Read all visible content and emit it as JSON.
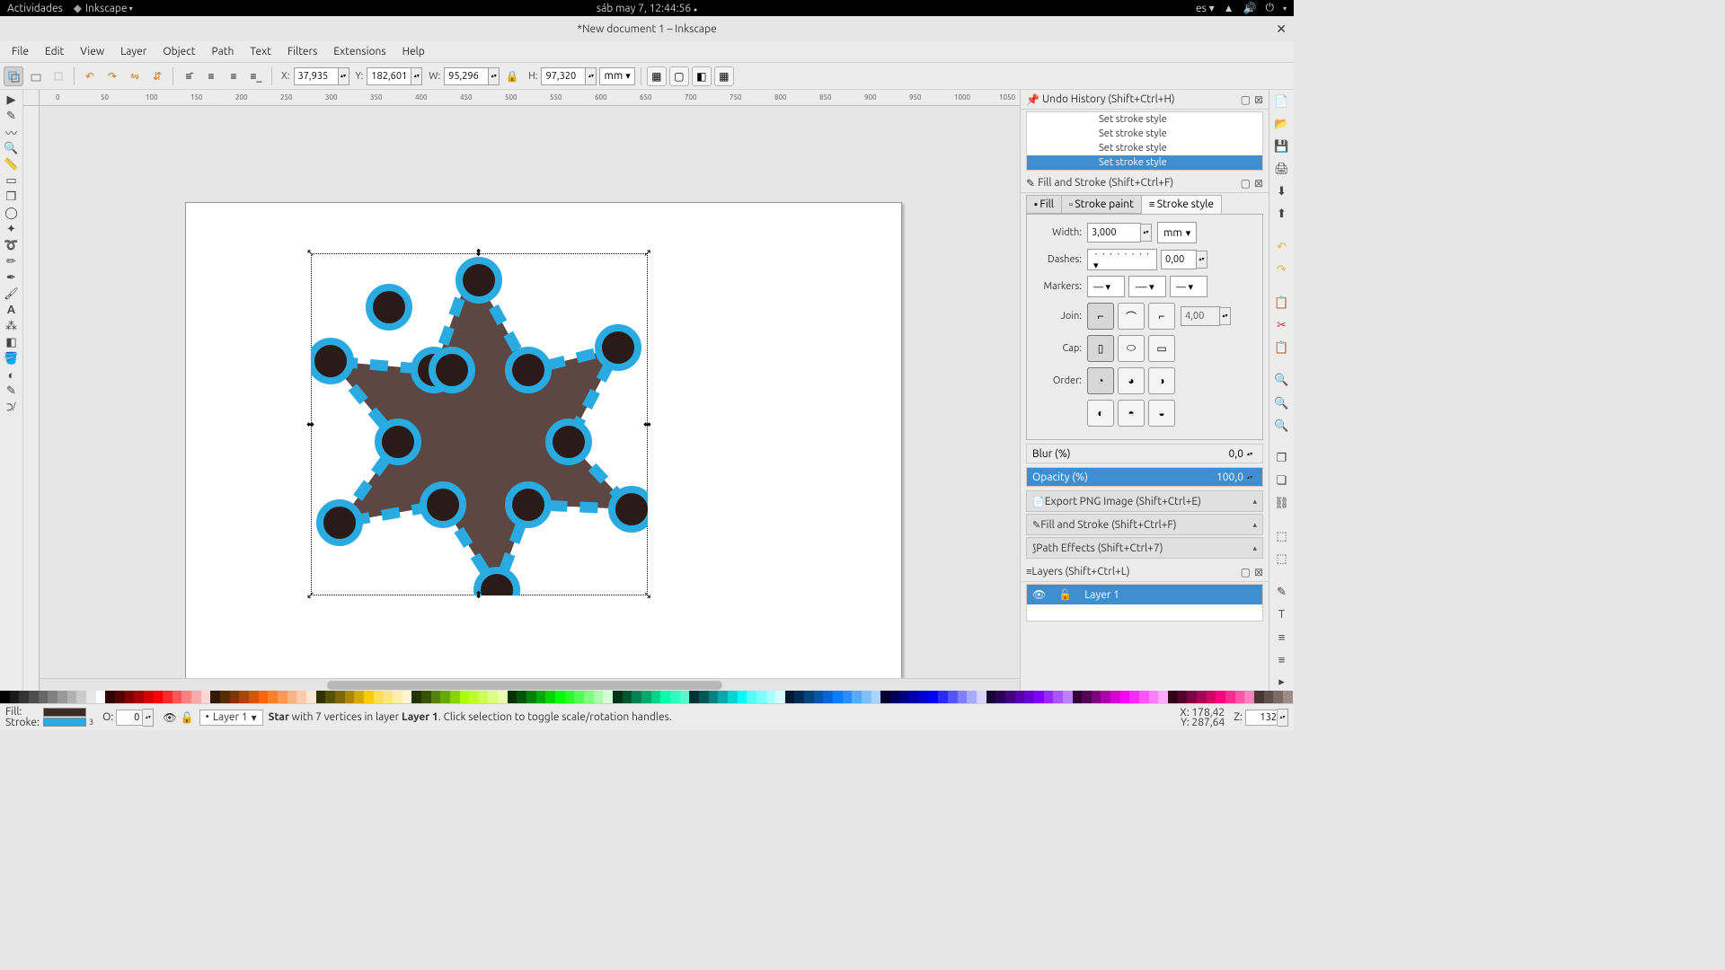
{
  "os_panel": {
    "activities": "Actividades",
    "app": "Inkscape",
    "clock": "sáb may  7, 12:44:56",
    "lang": "es"
  },
  "window": {
    "title": "*New document 1 – Inkscape",
    "close": "✕"
  },
  "menus": [
    "File",
    "Edit",
    "View",
    "Layer",
    "Object",
    "Path",
    "Text",
    "Filters",
    "Extensions",
    "Help"
  ],
  "tool_options": {
    "x_label": "X:",
    "x": "37,935",
    "y_label": "Y:",
    "y": "182,601",
    "w_label": "W:",
    "w": "95,296",
    "h_label": "H:",
    "h": "97,320",
    "units": "mm"
  },
  "ruler_marks": [
    "0",
    "50",
    "100",
    "150",
    "200",
    "250",
    "300",
    "350",
    "400",
    "450",
    "500",
    "550",
    "600",
    "650",
    "700",
    "750",
    "800",
    "850",
    "900",
    "950",
    "1000",
    "1050"
  ],
  "undo_history": {
    "title": "Undo History",
    "shortcut": "(Shift+Ctrl+H)",
    "items": [
      "Set stroke style",
      "Set stroke style",
      "Set stroke style",
      "Set stroke style"
    ]
  },
  "fill_stroke": {
    "title": "Fill and Stroke",
    "shortcut": "(Shift+Ctrl+F)",
    "tabs": {
      "fill": "Fill",
      "paint": "Stroke paint",
      "style": "Stroke style"
    },
    "width_label": "Width:",
    "width": "3,000",
    "width_unit": "mm",
    "dashes_label": "Dashes:",
    "dash_val": "0,00",
    "markers_label": "Markers:",
    "join_label": "Join:",
    "join_val": "4,00",
    "cap_label": "Cap:",
    "order_label": "Order:",
    "blur_label": "Blur (%)",
    "blur": "0,0",
    "opacity_label": "Opacity (%)",
    "opacity": "100,0"
  },
  "collapsibles": {
    "export": "Export PNG Image (Shift+Ctrl+E)",
    "fillstroke": "Fill and Stroke (Shift+Ctrl+F)",
    "patheffects": "Path Effects  (Shift+Ctrl+7)"
  },
  "layers": {
    "title": "Layers",
    "shortcut": "(Shift+Ctrl+L)",
    "layer": "Layer 1"
  },
  "status": {
    "fill_label": "Fill:",
    "stroke_label": "Stroke:",
    "stroke_num": "3",
    "o_label": "O:",
    "o_val": "0",
    "layer": "Layer 1",
    "msg_pre": "Star",
    "msg_mid": " with 7 vertices in layer ",
    "msg_layer": "Layer 1",
    "msg_post": ". Click selection to toggle scale/rotation handles.",
    "coord_x": "X:   178,42",
    "coord_y": "Y:   287,64",
    "z_label": "Z:",
    "zoom": "132"
  },
  "palette_colors": [
    "#000000",
    "#1a1a1a",
    "#333333",
    "#4d4d4d",
    "#666666",
    "#808080",
    "#999999",
    "#b3b3b3",
    "#cccccc",
    "#e6e6e6",
    "#ffffff",
    "#330000",
    "#550000",
    "#800000",
    "#aa0000",
    "#d40000",
    "#ff0000",
    "#ff2a2a",
    "#ff5555",
    "#ff8080",
    "#ffaaaa",
    "#ffd5d5",
    "#331900",
    "#552b00",
    "#803300",
    "#aa4400",
    "#d45500",
    "#ff6600",
    "#ff7f2a",
    "#ff9955",
    "#ffb380",
    "#ffccaa",
    "#ffe6d5",
    "#333000",
    "#555000",
    "#806600",
    "#aa8800",
    "#d4aa00",
    "#ffcc00",
    "#ffdd55",
    "#ffe680",
    "#ffeeaa",
    "#fff6d5",
    "#223300",
    "#335500",
    "#558000",
    "#66aa00",
    "#88d400",
    "#aaff00",
    "#bfff2a",
    "#ccff55",
    "#ddff80",
    "#eaffaa",
    "#003300",
    "#005500",
    "#008000",
    "#00aa00",
    "#00d400",
    "#00ff00",
    "#2aff2a",
    "#55ff55",
    "#80ff80",
    "#aaffaa",
    "#d5ffd5",
    "#003319",
    "#00552b",
    "#008055",
    "#00aa6e",
    "#00d488",
    "#00ffaa",
    "#2affbf",
    "#55ffcc",
    "#003333",
    "#005555",
    "#008080",
    "#00aaaa",
    "#00d4d4",
    "#00ffff",
    "#55ffff",
    "#80ffff",
    "#aaffff",
    "#d5ffff",
    "#001933",
    "#002b55",
    "#004480",
    "#0055aa",
    "#0066d4",
    "#0080ff",
    "#2a8cff",
    "#55aaff",
    "#80bfff",
    "#aad4ff",
    "#000033",
    "#000055",
    "#000080",
    "#0000aa",
    "#0000d4",
    "#0000ff",
    "#2a2aff",
    "#5555ff",
    "#8080ff",
    "#aaaaff",
    "#d5d5ff",
    "#190033",
    "#2b0055",
    "#440080",
    "#5500aa",
    "#6600d4",
    "#7f00ff",
    "#942aff",
    "#aa55ff",
    "#bf80ff",
    "#330033",
    "#550055",
    "#800080",
    "#aa00aa",
    "#d400d4",
    "#ff00ff",
    "#ff2aff",
    "#ff55ff",
    "#ff80ff",
    "#ffaaff",
    "#330019",
    "#55002b",
    "#800044",
    "#aa0055",
    "#d40066",
    "#ff0080",
    "#ff2a94",
    "#ff55aa",
    "#ff80bf",
    "#483737",
    "#605050",
    "#7d6b6b",
    "#9c8c8c"
  ]
}
